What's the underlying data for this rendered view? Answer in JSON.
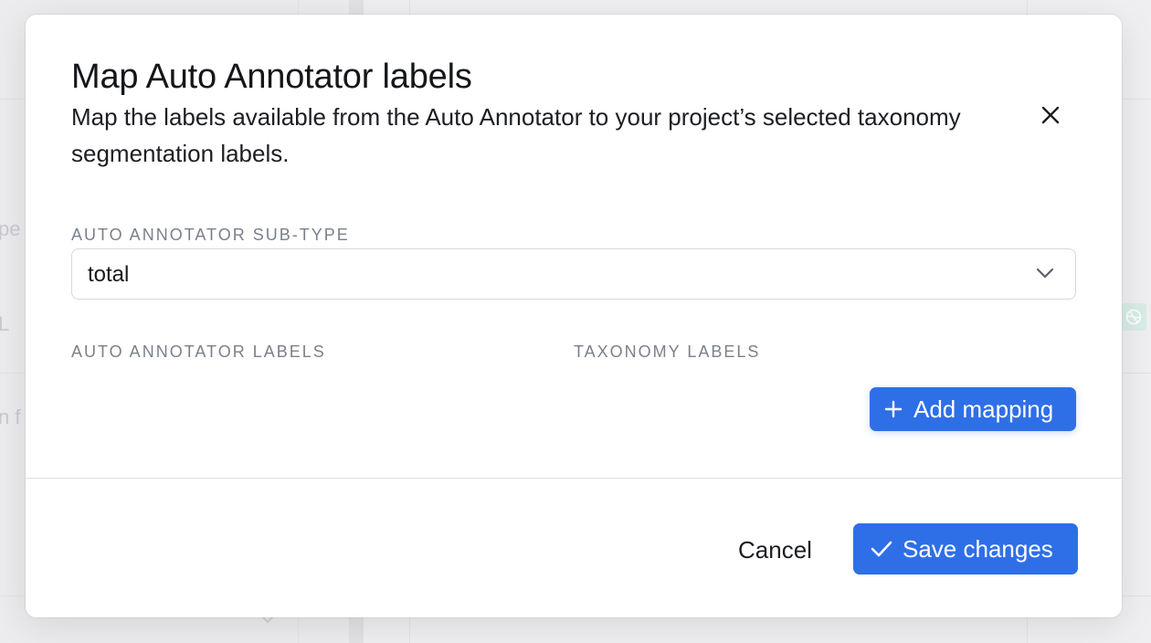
{
  "background": {
    "fragments": [
      "pe",
      "L",
      "n f"
    ]
  },
  "modal": {
    "title": "Map Auto Annotator labels",
    "description": "Map the labels available from the Auto Annotator to your project’s selected taxonomy segmentation labels.",
    "close_icon": "close-icon"
  },
  "subtype": {
    "label": "AUTO ANNOTATOR SUB-TYPE",
    "value": "total",
    "icon": "chevron-down-icon"
  },
  "mapping": {
    "auto_label": "AUTO ANNOTATOR LABELS",
    "taxonomy_label": "TAXONOMY LABELS",
    "add_button": "Add mapping",
    "add_icon": "plus-icon"
  },
  "footer": {
    "cancel": "Cancel",
    "save": "Save changes",
    "save_icon": "check-icon"
  },
  "colors": {
    "primary": "#2e6fe8",
    "label_gray": "#7b808a",
    "border": "#d6d8dd",
    "chip_green": "#d9ece6"
  }
}
